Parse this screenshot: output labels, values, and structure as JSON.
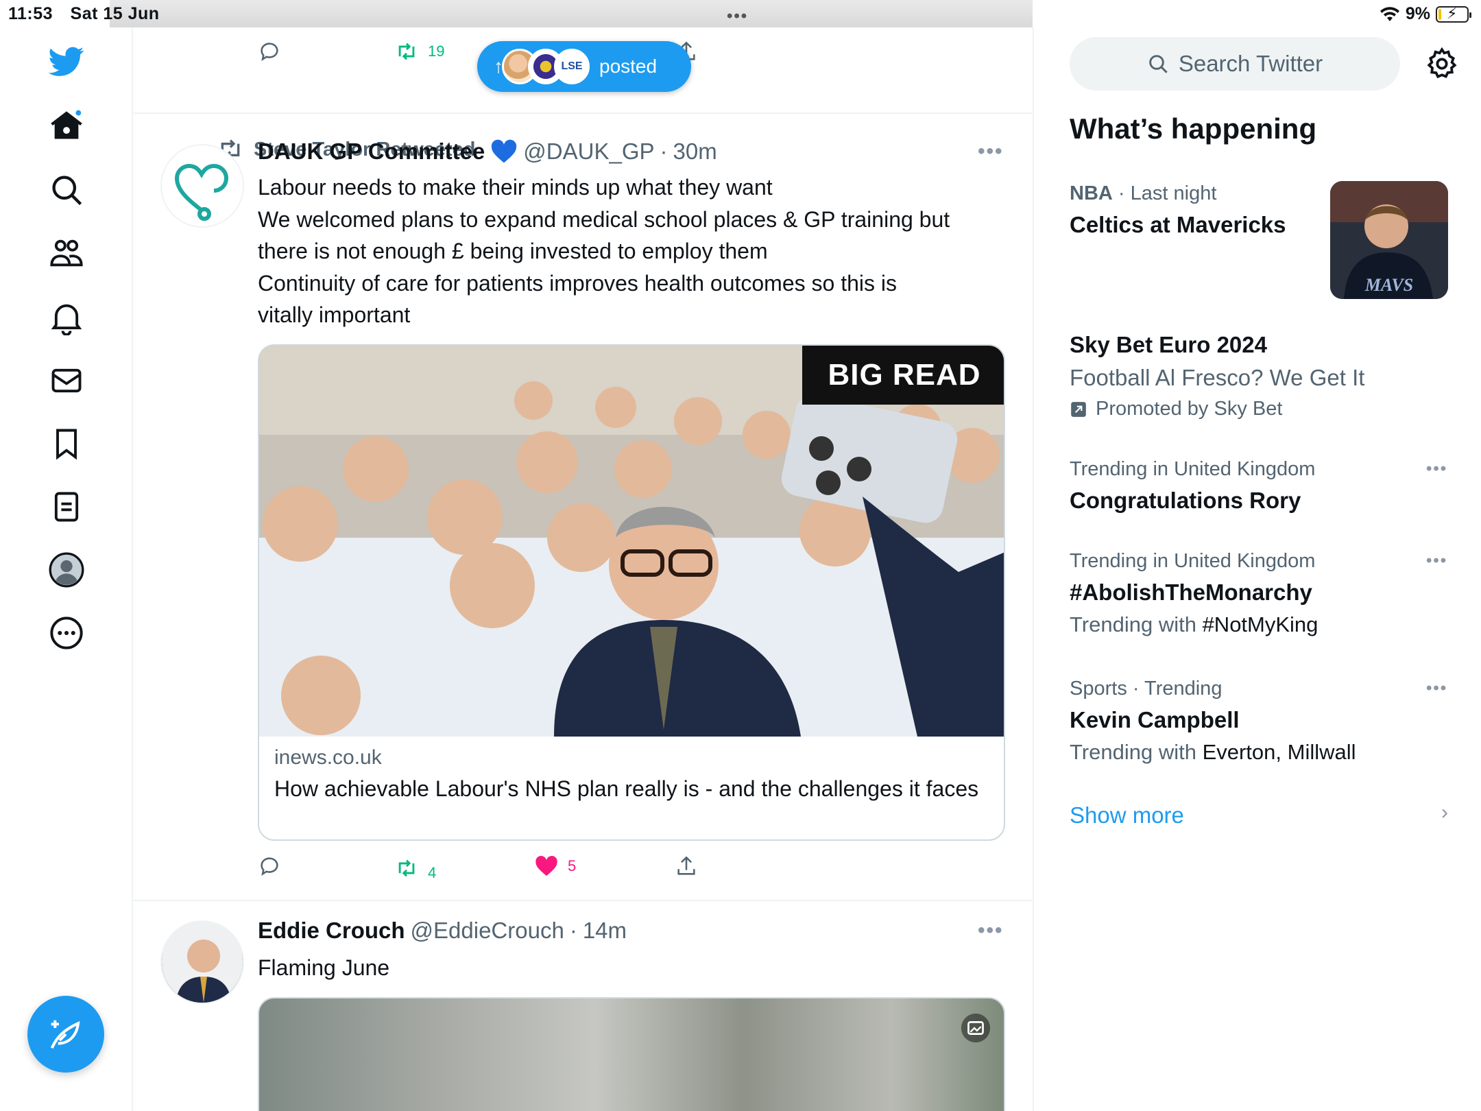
{
  "status_bar": {
    "time": "11:53",
    "date": "Sat 15 Jun",
    "grabber": "•••",
    "battery_percent": "9%",
    "battery_level": 0.09
  },
  "nav": {
    "items": [
      {
        "name": "home",
        "icon": "home-icon"
      },
      {
        "name": "explore",
        "icon": "search-icon"
      },
      {
        "name": "communities",
        "icon": "people-icon"
      },
      {
        "name": "notifications",
        "icon": "bell-icon"
      },
      {
        "name": "messages",
        "icon": "mail-icon"
      },
      {
        "name": "bookmarks",
        "icon": "bookmark-icon"
      },
      {
        "name": "lists",
        "icon": "list-icon"
      },
      {
        "name": "profile",
        "icon": "avatar-icon"
      },
      {
        "name": "more",
        "icon": "more-icon"
      }
    ]
  },
  "posted_pill": {
    "label": "posted"
  },
  "prev_tweet": {
    "retweets": "19"
  },
  "tweet1": {
    "retweeted_by": "Steve Taylor Retweeted",
    "name": "DAUK GP Committee",
    "handle": "@DAUK_GP",
    "sep": "·",
    "time": "30m",
    "lines": [
      "Labour needs to make their minds up what they want",
      "We welcomed plans to expand medical school places & GP training but",
      "there is not enough £ being invested to employ them",
      "Continuity of care for patients improves health outcomes so this is",
      "vitally important"
    ],
    "card": {
      "badge": "BIG READ",
      "domain": "inews.co.uk",
      "title": "How achievable Labour's NHS plan really is - and the challenges it faces"
    },
    "retweets": "4",
    "likes": "5"
  },
  "tweet2": {
    "name": "Eddie Crouch",
    "handle": "@EddieCrouch",
    "sep": "·",
    "time": "14m",
    "text": "Flaming June"
  },
  "sidebar": {
    "search_placeholder": "Search Twitter",
    "heading": "What’s happening",
    "trends": [
      {
        "cat_a": "NBA",
        "cat_b": "· Last night",
        "title": "Celtics at Mavericks"
      },
      {
        "title": "Sky Bet Euro 2024",
        "sub": "Football Al Fresco? We Get It",
        "promo": "Promoted by Sky Bet"
      },
      {
        "cat": "Trending in United Kingdom",
        "title": "Congratulations Rory"
      },
      {
        "cat": "Trending in United Kingdom",
        "title": "#AbolishTheMonarchy",
        "sub_pre": "Trending with ",
        "sub_b": "#NotMyKing"
      },
      {
        "cat": "Sports · Trending",
        "title": "Kevin Campbell",
        "sub_pre": "Trending with ",
        "sub_b": "Everton, Millwall"
      }
    ],
    "show_more": "Show more"
  },
  "colors": {
    "accent": "#1d9bf0",
    "retweet": "#00ba7c",
    "like": "#f91880",
    "muted": "#536471"
  }
}
